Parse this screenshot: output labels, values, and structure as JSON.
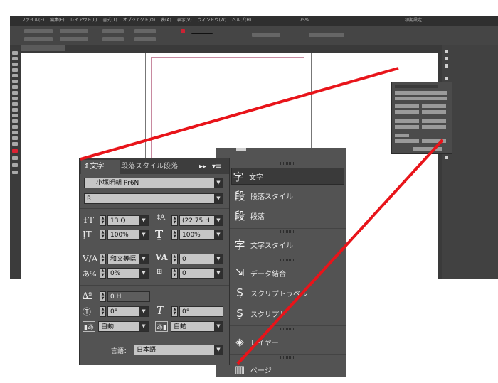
{
  "app": {
    "menu": [
      "ファイル(F)",
      "編集(E)",
      "レイアウト(L)",
      "書式(T)",
      "オブジェクト(O)",
      "表(A)",
      "表示(V)",
      "ウィンドウ(W)",
      "ヘルプ(H)"
    ],
    "zoom": "75%",
    "workspace": "初期設定"
  },
  "list_panel": {
    "items": [
      {
        "label": "文字",
        "icon": "character-icon",
        "selected": true
      },
      {
        "label": "段落スタイル",
        "icon": "paragraph-style-icon"
      },
      {
        "label": "段落",
        "icon": "paragraph-icon"
      },
      {
        "label": "文字スタイル",
        "icon": "character-style-icon"
      },
      {
        "label": "データ結合",
        "icon": "data-merge-icon"
      },
      {
        "label": "スクリプトラベル",
        "icon": "script-label-icon"
      },
      {
        "label": "スクリプト",
        "icon": "script-icon"
      },
      {
        "label": "レイヤー",
        "icon": "layers-icon"
      },
      {
        "label": "ページ",
        "icon": "pages-icon"
      }
    ]
  },
  "char_panel": {
    "tabs": [
      "文字",
      "段落スタイル",
      "段落"
    ],
    "font_family": "小塚明朝 Pr6N",
    "font_style": "R",
    "font_size": "13 Q",
    "leading": "(22.75 H",
    "vertical_scale": "100%",
    "horizontal_scale": "100%",
    "kerning": "和文等幅",
    "tracking": "0",
    "tsume": "0%",
    "mojikumi": "0",
    "baseline_shift": "0 H",
    "rotation": "0°",
    "skew": "0°",
    "aki_before": "自動",
    "aki_after": "自動",
    "language_label": "言語：",
    "language": "日本語"
  },
  "colors": {
    "callout_red": "#e8141a",
    "panel_bg": "#535353",
    "app_bg": "#3a3a3a"
  }
}
